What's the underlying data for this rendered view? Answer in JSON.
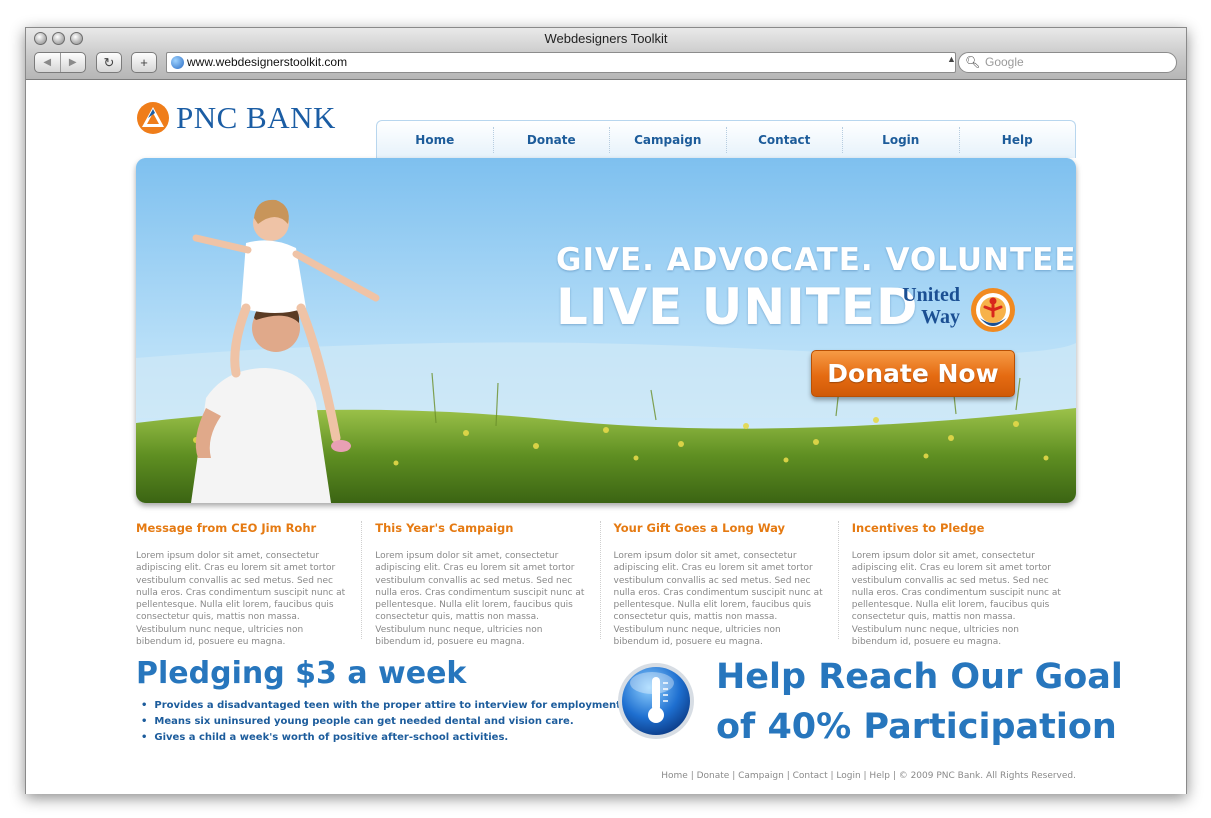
{
  "browser": {
    "window_title": "Webdesigners Toolkit",
    "url": "www.webdesignerstoolkit.com",
    "search_placeholder": "Google",
    "back_glyph": "◀",
    "forward_glyph": "▶",
    "reload_glyph": "↻",
    "add_glyph": "+"
  },
  "logo": {
    "text": "PNC BANK",
    "icon": "pnc-triangle-icon"
  },
  "nav": {
    "items": [
      "Home",
      "Donate",
      "Campaign",
      "Contact",
      "Login",
      "Help"
    ]
  },
  "hero": {
    "headline": "GIVE. ADVOCATE. VOLUNTEER.",
    "tagline": "LIVE UNITED",
    "partner_name_1": "United",
    "partner_name_2": "Way",
    "cta_label": "Donate Now"
  },
  "columns": [
    {
      "title": "Message from CEO Jim Rohr",
      "body": "Lorem ipsum dolor sit amet, consectetur adipiscing elit. Cras eu lorem sit amet tortor vestibulum convallis ac sed metus. Sed nec nulla eros. Cras condimentum suscipit nunc at pellentesque. Nulla elit lorem, faucibus quis consectetur quis, mattis non massa. Vestibulum nunc neque, ultricies non bibendum id, posuere eu magna."
    },
    {
      "title": "This Year's Campaign",
      "body": "Lorem ipsum dolor sit amet, consectetur adipiscing elit. Cras eu lorem sit amet tortor vestibulum convallis ac sed metus. Sed nec nulla eros. Cras condimentum suscipit nunc at pellentesque. Nulla elit lorem, faucibus quis consectetur quis, mattis non massa. Vestibulum nunc neque, ultricies non bibendum id, posuere eu magna."
    },
    {
      "title": "Your Gift Goes a Long Way",
      "body": "Lorem ipsum dolor sit amet, consectetur adipiscing elit. Cras eu lorem sit amet tortor vestibulum convallis ac sed metus. Sed nec nulla eros. Cras condimentum suscipit nunc at pellentesque. Nulla elit lorem, faucibus quis consectetur quis, mattis non massa. Vestibulum nunc neque, ultricies non bibendum id, posuere eu magna."
    },
    {
      "title": "Incentives to Pledge",
      "body": "Lorem ipsum dolor sit amet, consectetur adipiscing elit. Cras eu lorem sit amet tortor vestibulum convallis ac sed metus. Sed nec nulla eros. Cras condimentum suscipit nunc at pellentesque. Nulla elit lorem, faucibus quis consectetur quis, mattis non massa. Vestibulum nunc neque, ultricies non bibendum id, posuere eu magna."
    }
  ],
  "pledge": {
    "title": "Pledging $3 a week",
    "bullets": [
      "Provides a disadvantaged teen with the proper attire to interview for employment.",
      "Means six uninsured young people can get needed dental and vision care.",
      "Gives a child a week's worth of positive after-school activities."
    ]
  },
  "goal": {
    "line1": "Help Reach Our Goal",
    "line2": "of 40% Participation",
    "icon": "thermometer-icon"
  },
  "footer": {
    "links": [
      "Home",
      "Donate",
      "Campaign",
      "Contact",
      "Login",
      "Help"
    ],
    "copyright": "© 2009 PNC Bank. All Rights Reserved."
  },
  "colors": {
    "brand_blue": "#1b5da4",
    "heading_blue": "#2776bd",
    "accent_orange": "#e57a12",
    "cta_orange": "#e56b12"
  }
}
